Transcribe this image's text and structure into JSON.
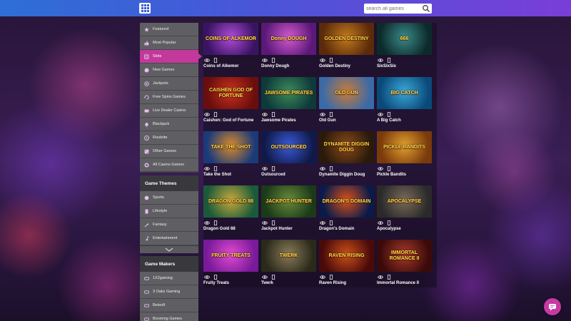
{
  "search": {
    "placeholder": "search all games"
  },
  "sidebar": {
    "categories": [
      {
        "label": "Featured",
        "icon": "star-icon"
      },
      {
        "label": "Most Popular",
        "icon": "thumbs-up-icon"
      },
      {
        "label": "Slots",
        "icon": "slot-machine-icon",
        "active": true
      },
      {
        "label": "New Games",
        "icon": "new-icon"
      },
      {
        "label": "Jackpots",
        "icon": "jackpot-icon"
      },
      {
        "label": "Free Spins Games",
        "icon": "free-spins-icon"
      },
      {
        "label": "Live Dealer Casino",
        "icon": "live-dealer-icon"
      },
      {
        "label": "Blackjack",
        "icon": "spade-icon"
      },
      {
        "label": "Roulette",
        "icon": "roulette-icon"
      },
      {
        "label": "Other Games",
        "icon": "dice-icon"
      },
      {
        "label": "All Casino Games",
        "icon": "casino-chip-icon"
      }
    ],
    "themes_heading": "Game Themes",
    "themes": [
      {
        "label": "Sports",
        "icon": "ball-icon"
      },
      {
        "label": "Lifestyle",
        "icon": "lifestyle-icon"
      },
      {
        "label": "Fantasy",
        "icon": "wand-icon"
      },
      {
        "label": "Entertainment",
        "icon": "music-note-icon"
      }
    ],
    "makers_heading": "Game Makers",
    "makers": [
      {
        "label": "1X2gaming",
        "icon": "maker-logo-icon"
      },
      {
        "label": "3 Oaks Gaming",
        "icon": "maker-logo-icon"
      },
      {
        "label": "Betsoft",
        "icon": "maker-logo-icon"
      },
      {
        "label": "Booming Games",
        "icon": "maker-logo-icon"
      }
    ]
  },
  "games": [
    {
      "name": "Coins of Alkemor",
      "thumb_text": "COINS OF ALKEMOR",
      "c1": "#3a1464",
      "c2": "#b04bd8"
    },
    {
      "name": "Donny Dough",
      "thumb_text": "Donny DOUGH",
      "c1": "#5a1878",
      "c2": "#d35ad0"
    },
    {
      "name": "Golden Destiny",
      "thumb_text": "GOLDEN DESTINY",
      "c1": "#5a2a0a",
      "c2": "#c27a1e"
    },
    {
      "name": "SixSixSix",
      "thumb_text": "666",
      "c1": "#0c2a2a",
      "c2": "#3a8a8a"
    },
    {
      "name": "Caishen: God of Fortune",
      "thumb_text": "CAISHEN GOD OF FORTUNE",
      "c1": "#6a0d0d",
      "c2": "#c8321e"
    },
    {
      "name": "Jawsome Pirates",
      "thumb_text": "JAWSOME PIRATES",
      "c1": "#0e3a3a",
      "c2": "#3c8a5a"
    },
    {
      "name": "Old Gun",
      "thumb_text": "OLD GUN",
      "c1": "#3a6aa8",
      "c2": "#c87a3a"
    },
    {
      "name": "A Big Catch",
      "thumb_text": "BIG CATCH",
      "c1": "#0a4a7a",
      "c2": "#3aa8d8"
    },
    {
      "name": "Take the Shot",
      "thumb_text": "TAKE THE SHOT",
      "c1": "#1a3a7a",
      "c2": "#d88a2a"
    },
    {
      "name": "Outsourced",
      "thumb_text": "OUTSOURCED",
      "c1": "#101a4a",
      "c2": "#3a5ad8"
    },
    {
      "name": "Dynamite Diggin Doug",
      "thumb_text": "DYNAMITE DIGGIN DOUG",
      "c1": "#2a1a0a",
      "c2": "#8a4a1a"
    },
    {
      "name": "Pickle Bandits",
      "thumb_text": "PICKLE BANDITS",
      "c1": "#7a3a0a",
      "c2": "#e0a030"
    },
    {
      "name": "Dragon Gold 88",
      "thumb_text": "DRAGON GOLD 88",
      "c1": "#1a5a3a",
      "c2": "#c8a83a"
    },
    {
      "name": "Jackpot Hunter",
      "thumb_text": "JACKPOT HUNTER",
      "c1": "#1a3a1a",
      "c2": "#6a8a3a"
    },
    {
      "name": "Dragon's Domain",
      "thumb_text": "DRAGON'S DOMAIN",
      "c1": "#0a1a4a",
      "c2": "#d8501a"
    },
    {
      "name": "Apocalypse",
      "thumb_text": "APOCALYPSE",
      "c1": "#2a2a2a",
      "c2": "#7a6a5a"
    },
    {
      "name": "Fruity Treats",
      "thumb_text": "FRUITY TREATS",
      "c1": "#7a1a9a",
      "c2": "#e04ad0"
    },
    {
      "name": "Twerk",
      "thumb_text": "TWERK",
      "c1": "#2a2a1a",
      "c2": "#8a7a5a"
    },
    {
      "name": "Raven Rising",
      "thumb_text": "RAVEN RISING",
      "c1": "#4a0a0a",
      "c2": "#c8501a"
    },
    {
      "name": "Immortal Romance II",
      "thumb_text": "IMMORTAL ROMANCE II",
      "c1": "#3a0a0a",
      "c2": "#a83a2a"
    }
  ],
  "colors": {
    "accent": "#c2399b",
    "topbar_start": "#2d6fd6",
    "topbar_end": "#7a3ed8"
  }
}
